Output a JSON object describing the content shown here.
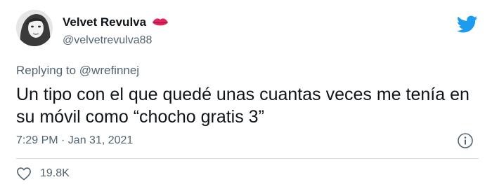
{
  "author": {
    "display_name": "Velvet Revulva",
    "handle": "@velvetrevulva88"
  },
  "reply": {
    "prefix": "Replying to",
    "mention": "@wrefinnej"
  },
  "tweet": {
    "text": "Un tipo con el que quedé unas cuantas veces me tenía en su móvil como “chocho gratis 3”",
    "timestamp": "7:29 PM · Jan 31, 2021"
  },
  "engagement": {
    "likes": "19.8K"
  },
  "colors": {
    "brand": "#1d9bf0",
    "secondary_text": "#536471",
    "lips": "#e0245e"
  }
}
